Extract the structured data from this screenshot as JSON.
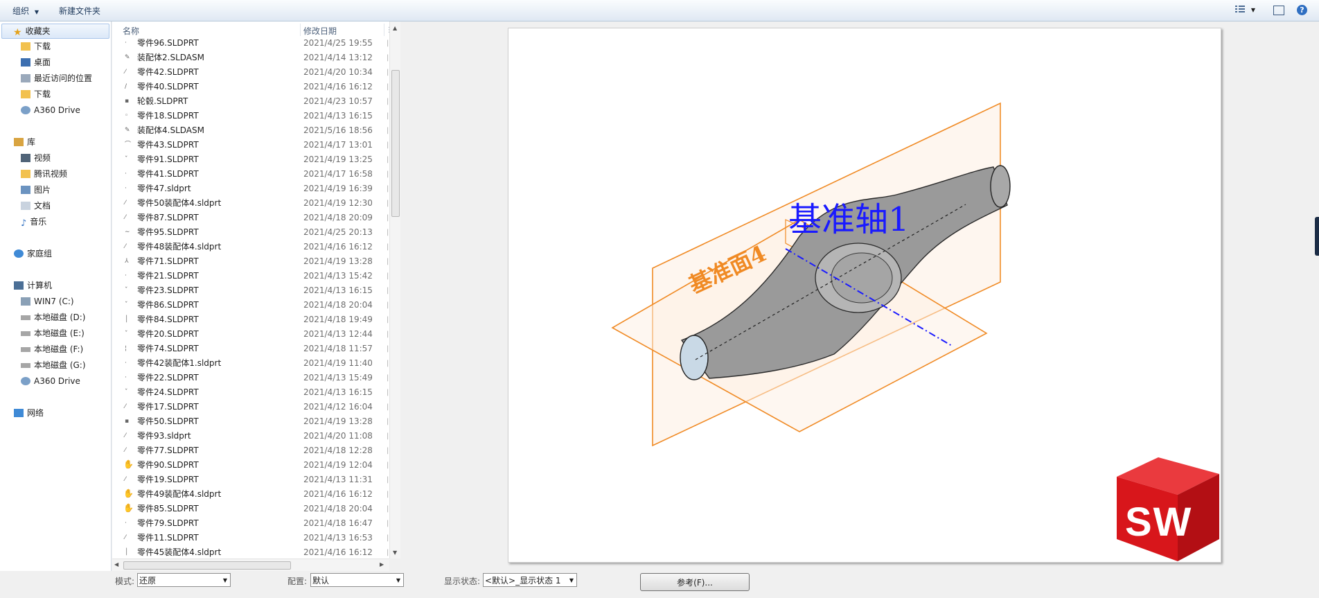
{
  "toolbar": {
    "organize": "组织",
    "new_folder": "新建文件夹"
  },
  "nav": {
    "favorites": "收藏夹",
    "fav_items": [
      "下载",
      "桌面",
      "最近访问的位置",
      "下载",
      "A360 Drive"
    ],
    "libraries": "库",
    "lib_items": [
      "视频",
      "腾讯视频",
      "图片",
      "文档",
      "音乐"
    ],
    "homegroup": "家庭组",
    "computer": "计算机",
    "drives": [
      "WIN7 (C:)",
      "本地磁盘 (D:)",
      "本地磁盘 (E:)",
      "本地磁盘 (F:)",
      "本地磁盘 (G:)",
      "A360 Drive"
    ],
    "network": "网络"
  },
  "columns": {
    "name": "名称",
    "modified": "修改日期"
  },
  "files": [
    {
      "name": "零件96.SLDPRT",
      "date": "2021/4/25 19:55"
    },
    {
      "name": "装配体2.SLDASM",
      "date": "2021/4/14 13:12"
    },
    {
      "name": "零件42.SLDPRT",
      "date": "2021/4/20 10:34"
    },
    {
      "name": "零件40.SLDPRT",
      "date": "2021/4/16 16:12"
    },
    {
      "name": "轮毂.SLDPRT",
      "date": "2021/4/23 10:57"
    },
    {
      "name": "零件18.SLDPRT",
      "date": "2021/4/13 16:15"
    },
    {
      "name": "装配体4.SLDASM",
      "date": "2021/5/16 18:56"
    },
    {
      "name": "零件43.SLDPRT",
      "date": "2021/4/17 13:01"
    },
    {
      "name": "零件91.SLDPRT",
      "date": "2021/4/19 13:25"
    },
    {
      "name": "零件41.SLDPRT",
      "date": "2021/4/17 16:58"
    },
    {
      "name": "零件47.sldprt",
      "date": "2021/4/19 16:39"
    },
    {
      "name": "零件50装配体4.sldprt",
      "date": "2021/4/19 12:30"
    },
    {
      "name": "零件87.SLDPRT",
      "date": "2021/4/18 20:09"
    },
    {
      "name": "零件95.SLDPRT",
      "date": "2021/4/25 20:13"
    },
    {
      "name": "零件48装配体4.sldprt",
      "date": "2021/4/16 16:12"
    },
    {
      "name": "零件71.SLDPRT",
      "date": "2021/4/19 13:28"
    },
    {
      "name": "零件21.SLDPRT",
      "date": "2021/4/13 15:42"
    },
    {
      "name": "零件23.SLDPRT",
      "date": "2021/4/13 16:15"
    },
    {
      "name": "零件86.SLDPRT",
      "date": "2021/4/18 20:04"
    },
    {
      "name": "零件84.SLDPRT",
      "date": "2021/4/18 19:49"
    },
    {
      "name": "零件20.SLDPRT",
      "date": "2021/4/13 12:44"
    },
    {
      "name": "零件74.SLDPRT",
      "date": "2021/4/18 11:57"
    },
    {
      "name": "零件42装配体1.sldprt",
      "date": "2021/4/19 11:40"
    },
    {
      "name": "零件22.SLDPRT",
      "date": "2021/4/13 15:49"
    },
    {
      "name": "零件24.SLDPRT",
      "date": "2021/4/13 16:15"
    },
    {
      "name": "零件17.SLDPRT",
      "date": "2021/4/12 16:04"
    },
    {
      "name": "零件50.SLDPRT",
      "date": "2021/4/19 13:28"
    },
    {
      "name": "零件93.sldprt",
      "date": "2021/4/20 11:08"
    },
    {
      "name": "零件77.SLDPRT",
      "date": "2021/4/18 12:28"
    },
    {
      "name": "零件90.SLDPRT",
      "date": "2021/4/19 12:04"
    },
    {
      "name": "零件19.SLDPRT",
      "date": "2021/4/13 11:31"
    },
    {
      "name": "零件49装配体4.sldprt",
      "date": "2021/4/16 16:12"
    },
    {
      "name": "零件85.SLDPRT",
      "date": "2021/4/18 20:04"
    },
    {
      "name": "零件79.SLDPRT",
      "date": "2021/4/18 16:47"
    },
    {
      "name": "零件11.SLDPRT",
      "date": "2021/4/13 16:53"
    },
    {
      "name": "零件45装配体4.sldprt",
      "date": "2021/4/16 16:12"
    }
  ],
  "preview": {
    "axis_label": "基准轴1",
    "plane_label": "基准面4",
    "logo_text": "SW"
  },
  "bottom": {
    "mode_label": "模式:",
    "mode_value": "还原",
    "config_label": "配置:",
    "config_value": "默认",
    "display_label": "显示状态:",
    "display_value": "<默认>_显示状态 1",
    "reference_button": "参考(F)..."
  },
  "colors": {
    "accent_blue": "#2f6fc2",
    "plane_orange": "#f08a24",
    "axis_blue": "#1a1aff",
    "logo_red": "#d8161b"
  }
}
